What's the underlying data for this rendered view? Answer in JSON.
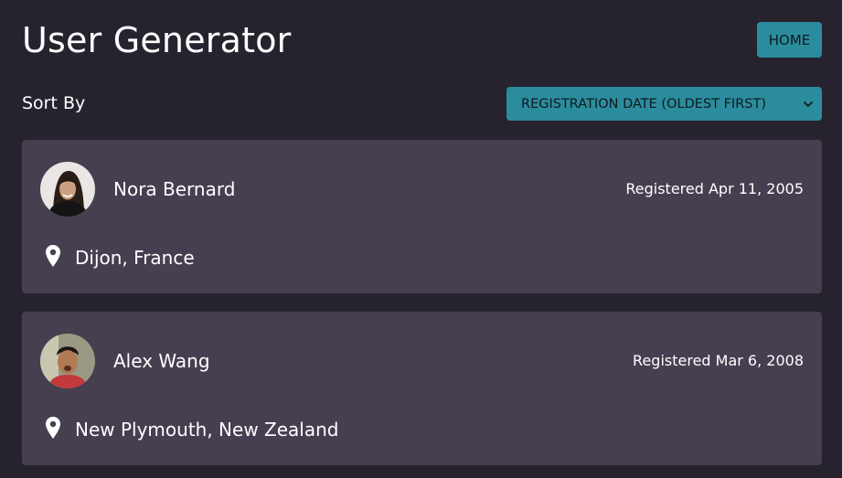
{
  "header": {
    "title": "User Generator",
    "home_label": "HOME"
  },
  "sort": {
    "label": "Sort By",
    "selected": "REGISTRATION DATE (OLDEST FIRST)"
  },
  "users": [
    {
      "name": "Nora Bernard",
      "registered": "Registered Apr 11, 2005",
      "location": "Dijon, France"
    },
    {
      "name": "Alex Wang",
      "registered": "Registered Mar 6, 2008",
      "location": "New Plymouth, New Zealand"
    }
  ],
  "colors": {
    "background": "#26232e",
    "card": "#463f50",
    "accent": "#2b8c9d"
  },
  "icons": {
    "location": "map-pin-icon",
    "dropdown": "chevron-down-icon"
  }
}
